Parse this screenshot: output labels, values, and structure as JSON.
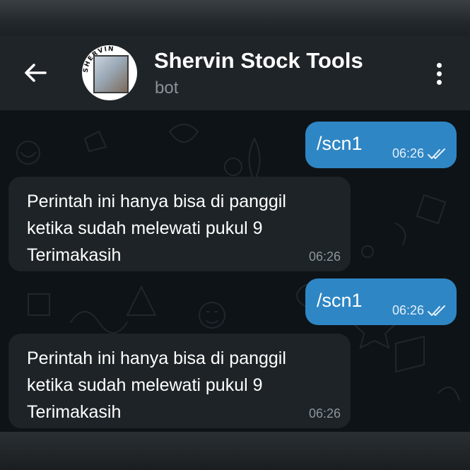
{
  "header": {
    "title": "Shervin Stock Tools",
    "subtitle": "bot",
    "back_icon": "arrow-left-icon",
    "menu_icon": "more-vertical-icon",
    "avatar_ring_text": "SHERVIN"
  },
  "colors": {
    "header_bg": "#1f2428",
    "chat_bg": "#0e1317",
    "outgoing_bubble": "#2f86c4",
    "incoming_bubble": "#1d2327"
  },
  "messages": [
    {
      "direction": "out",
      "text": "/scn1",
      "time": "06:26",
      "status": "read"
    },
    {
      "direction": "in",
      "lines": [
        "Perintah ini hanya bisa di panggil",
        "ketika sudah melewati pukul 9",
        "Terimakasih"
      ],
      "time": "06:26"
    },
    {
      "direction": "out",
      "text": "/scn1",
      "time": "06:26",
      "status": "read"
    },
    {
      "direction": "in",
      "lines": [
        "Perintah ini hanya bisa di panggil",
        "ketika sudah melewati pukul 9",
        "Terimakasih"
      ],
      "time": "06:26"
    }
  ]
}
